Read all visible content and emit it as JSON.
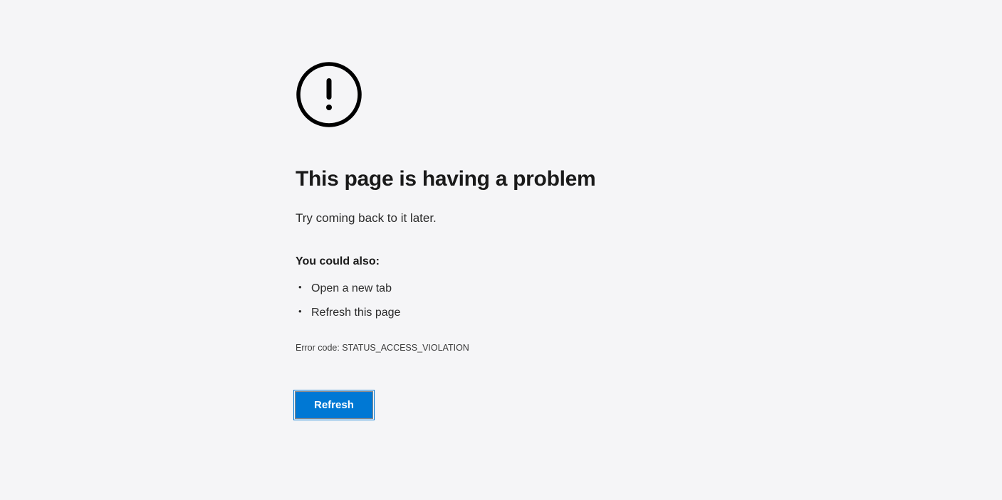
{
  "error": {
    "title": "This page is having a problem",
    "subtitle": "Try coming back to it later.",
    "suggestions_heading": "You could also:",
    "suggestions": [
      "Open a new tab",
      "Refresh this page"
    ],
    "error_code": "Error code: STATUS_ACCESS_VIOLATION",
    "refresh_button_label": "Refresh"
  }
}
